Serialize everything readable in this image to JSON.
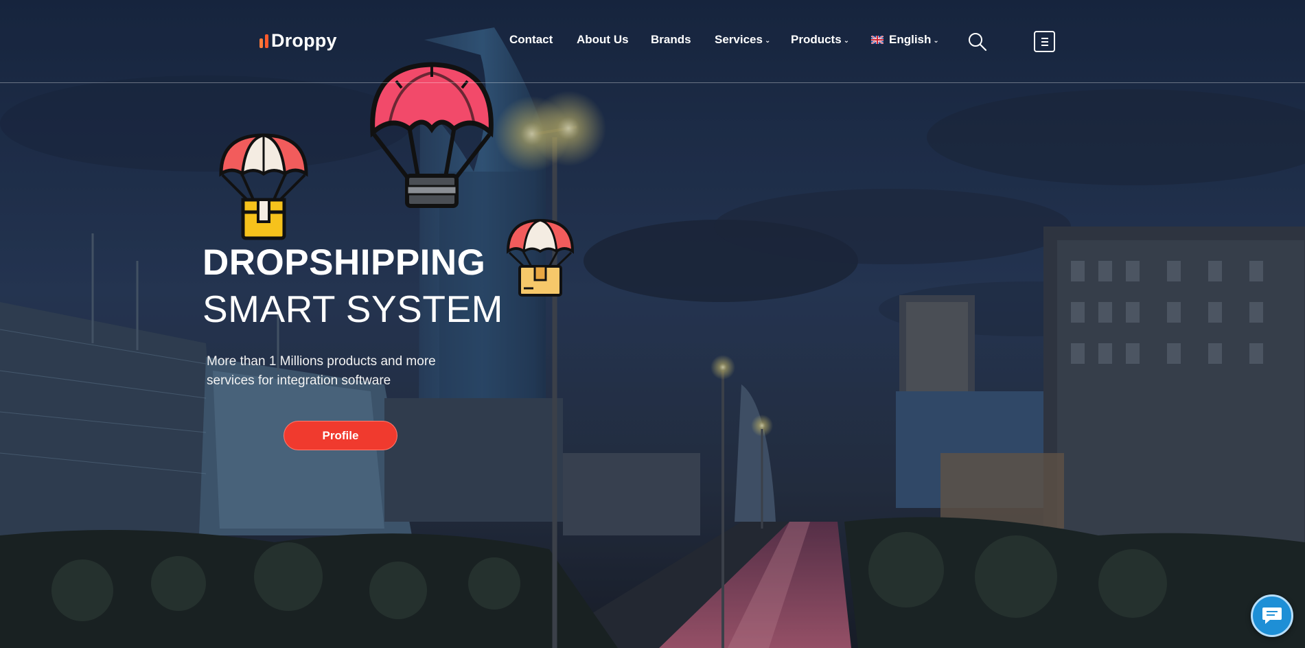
{
  "brand": {
    "name": "Droppy",
    "accent": "#ff5a2c"
  },
  "nav": {
    "items": [
      {
        "label": "Contact",
        "dropdown": false
      },
      {
        "label": "About Us",
        "dropdown": false
      },
      {
        "label": "Brands",
        "dropdown": false
      },
      {
        "label": "Services",
        "dropdown": true
      },
      {
        "label": "Products",
        "dropdown": true
      }
    ],
    "language": {
      "label": "English",
      "flag": "uk-flag-icon",
      "dropdown": true
    },
    "search_icon": "search-icon",
    "menu_icon": "menu-icon"
  },
  "hero": {
    "title": "DROPSHIPPING",
    "subtitle": "SMART SYSTEM",
    "description": "More than 1 Millions products and more services for integration software",
    "cta_label": "Profile",
    "cta_color": "#f03a2e"
  },
  "chat": {
    "icon": "chat-bubble-icon",
    "color": "#1e8fd6"
  }
}
